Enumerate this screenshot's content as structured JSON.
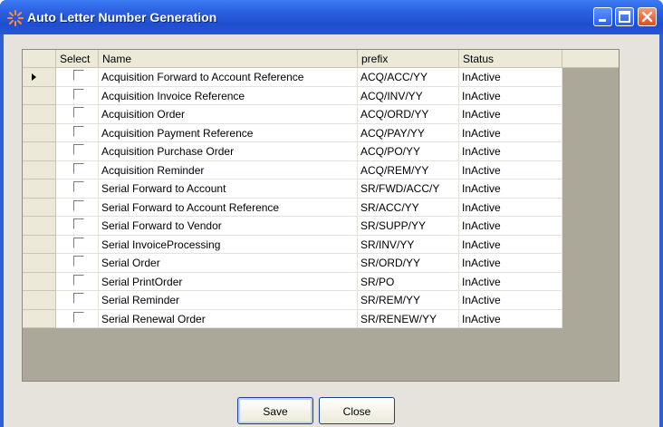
{
  "window": {
    "title": "Auto Letter Number Generation",
    "colors": {
      "titlebar": "#2a5fe0",
      "client": "#e6e2dc",
      "grid_empty": "#aca899"
    }
  },
  "grid": {
    "columns": {
      "select": "Select",
      "name": "Name",
      "prefix": "prefix",
      "status": "Status"
    },
    "rows": [
      {
        "name": "Acquisition Forward to Account Reference",
        "prefix": "ACQ/ACC/YY",
        "status": "InActive",
        "selected": false,
        "current": true
      },
      {
        "name": "Acquisition Invoice Reference",
        "prefix": "ACQ/INV/YY",
        "status": "InActive",
        "selected": false,
        "current": false
      },
      {
        "name": "Acquisition Order",
        "prefix": "ACQ/ORD/YY",
        "status": "InActive",
        "selected": false,
        "current": false
      },
      {
        "name": "Acquisition Payment Reference",
        "prefix": "ACQ/PAY/YY",
        "status": "InActive",
        "selected": false,
        "current": false
      },
      {
        "name": "Acquisition Purchase Order",
        "prefix": "ACQ/PO/YY",
        "status": "InActive",
        "selected": false,
        "current": false
      },
      {
        "name": "Acquisition Reminder",
        "prefix": "ACQ/REM/YY",
        "status": "InActive",
        "selected": false,
        "current": false
      },
      {
        "name": "Serial Forward to Account",
        "prefix": "SR/FWD/ACC/Y",
        "status": "InActive",
        "selected": false,
        "current": false
      },
      {
        "name": "Serial Forward to Account Reference",
        "prefix": "SR/ACC/YY",
        "status": "InActive",
        "selected": false,
        "current": false
      },
      {
        "name": "Serial Forward to Vendor",
        "prefix": "SR/SUPP/YY",
        "status": "InActive",
        "selected": false,
        "current": false
      },
      {
        "name": "Serial InvoiceProcessing",
        "prefix": "SR/INV/YY",
        "status": "InActive",
        "selected": false,
        "current": false
      },
      {
        "name": "Serial Order",
        "prefix": "SR/ORD/YY",
        "status": "InActive",
        "selected": false,
        "current": false
      },
      {
        "name": "Serial PrintOrder",
        "prefix": "SR/PO",
        "status": "InActive",
        "selected": false,
        "current": false
      },
      {
        "name": "Serial Reminder",
        "prefix": "SR/REM/YY",
        "status": "InActive",
        "selected": false,
        "current": false
      },
      {
        "name": "Serial Renewal Order",
        "prefix": "SR/RENEW/YY",
        "status": "InActive",
        "selected": false,
        "current": false
      }
    ]
  },
  "buttons": {
    "save": "Save",
    "close": "Close"
  },
  "icons": {
    "app": "app-icon",
    "minimize": "minimize-icon",
    "maximize": "maximize-icon",
    "close": "close-icon",
    "row_pointer": "row-pointer-icon"
  }
}
